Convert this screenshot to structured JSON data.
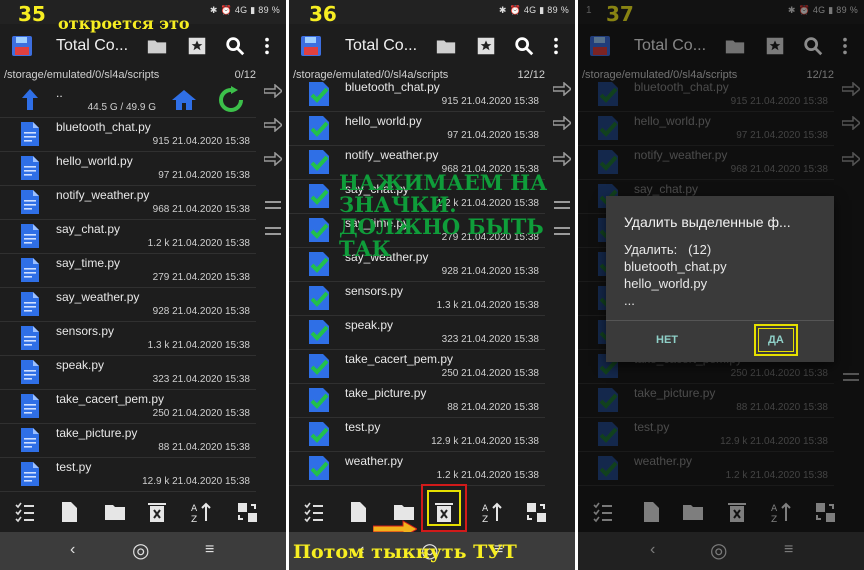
{
  "captions": {
    "step1": "35",
    "step2": "36",
    "step3": "37",
    "opens_this": "откроется это",
    "tap_icons": "НАЖИМАЕМ НА ЗНАЧКИ. ДОЛЖНО БЫТЬ ТАК",
    "then_tap_here": "Потом тыкнуть ТУТ"
  },
  "colors": {
    "caption_yellow": "#f7ee22",
    "note_green": "#0f9d3a",
    "highlight_red": "#d11a1a",
    "highlight_yellow": "#e6e000",
    "file_blue": "#2f6fe6",
    "check_green": "#22c14a"
  },
  "status": {
    "right_text": "✱ ⏰ 4G ▮ 89 %",
    "left_text": "1"
  },
  "toolbar": {
    "title_left": "Total Co...",
    "title_mid": "Total Co...",
    "icons": [
      "save-icon",
      "folder-icon",
      "bookmark-star-icon",
      "search-icon",
      "more-vert-icon"
    ]
  },
  "path": {
    "value": "/storage/emulated/0/sl4a/scripts",
    "count_none": "0/12",
    "count_all": "12/12"
  },
  "parent_row": {
    "name": "..",
    "meta": "44.5 G / 49.9 G"
  },
  "files": [
    {
      "name": "bluetooth_chat.py",
      "size": "915",
      "date": "21.04.2020",
      "time": "15:38"
    },
    {
      "name": "hello_world.py",
      "size": "97",
      "date": "21.04.2020",
      "time": "15:38"
    },
    {
      "name": "notify_weather.py",
      "size": "968",
      "date": "21.04.2020",
      "time": "15:38"
    },
    {
      "name": "say_chat.py",
      "size": "1.2 k",
      "date": "21.04.2020",
      "time": "15:38"
    },
    {
      "name": "say_time.py",
      "size": "279",
      "date": "21.04.2020",
      "time": "15:38"
    },
    {
      "name": "say_weather.py",
      "size": "928",
      "date": "21.04.2020",
      "time": "15:38"
    },
    {
      "name": "sensors.py",
      "size": "1.3 k",
      "date": "21.04.2020",
      "time": "15:38"
    },
    {
      "name": "speak.py",
      "size": "323",
      "date": "21.04.2020",
      "time": "15:38"
    },
    {
      "name": "take_cacert_pem.py",
      "size": "250",
      "date": "21.04.2020",
      "time": "15:38"
    },
    {
      "name": "take_picture.py",
      "size": "88",
      "date": "21.04.2020",
      "time": "15:38"
    },
    {
      "name": "test.py",
      "size": "12.9 k",
      "date": "21.04.2020",
      "time": "15:38"
    },
    {
      "name": "weather.py",
      "size": "1.2 k",
      "date": "21.04.2020",
      "time": "15:38"
    }
  ],
  "bottombar": {
    "icons": [
      "checklist-icon",
      "new-file-icon",
      "new-folder-icon",
      "delete-icon",
      "sort-icon",
      "swap-panels-icon"
    ]
  },
  "navbar": {
    "back": "‹",
    "home": "◎",
    "menu": "≡"
  },
  "dialog": {
    "title": "Удалить выделенные ф...",
    "label": "Удалить:",
    "count": "(12)",
    "item1": "bluetooth_chat.py",
    "item2": "hello_world.py",
    "more": "...",
    "no": "НЕТ",
    "yes": "ДА"
  }
}
